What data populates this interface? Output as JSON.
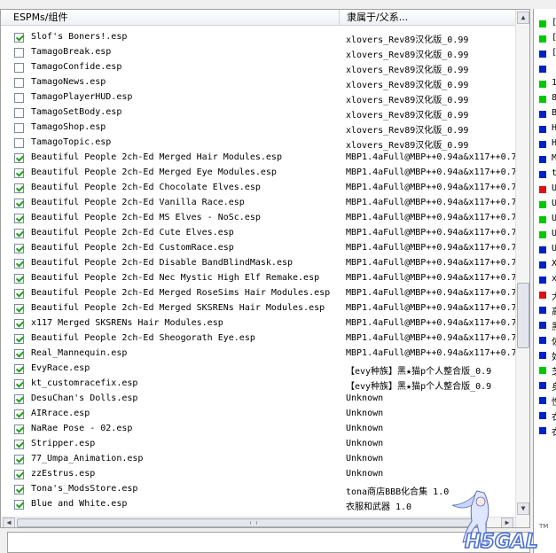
{
  "header": {
    "col1": "ESPMs/组件",
    "col2": "隶属于/父系..."
  },
  "rows": [
    {
      "checked": true,
      "name": "Slof's Boners!.esp",
      "master": "xlovers_Rev89汉化版_0.99"
    },
    {
      "checked": false,
      "name": "TamagoBreak.esp",
      "master": "xlovers_Rev89汉化版_0.99"
    },
    {
      "checked": false,
      "name": "TamagoConfide.esp",
      "master": "xlovers_Rev89汉化版_0.99"
    },
    {
      "checked": false,
      "name": "TamagoNews.esp",
      "master": "xlovers_Rev89汉化版_0.99"
    },
    {
      "checked": false,
      "name": "TamagoPlayerHUD.esp",
      "master": "xlovers_Rev89汉化版_0.99"
    },
    {
      "checked": false,
      "name": "TamagoSetBody.esp",
      "master": "xlovers_Rev89汉化版_0.99"
    },
    {
      "checked": false,
      "name": "TamagoShop.esp",
      "master": "xlovers_Rev89汉化版_0.99"
    },
    {
      "checked": false,
      "name": "TamagoTopic.esp",
      "master": "xlovers_Rev89汉化版_0.99"
    },
    {
      "checked": true,
      "name": "Beautiful People 2ch-Ed Merged Hair Modules.esp",
      "master": "MBP1.4aFull@MBP++0.94a&x117++0.7"
    },
    {
      "checked": true,
      "name": "Beautiful People 2ch-Ed Merged Eye Modules.esp",
      "master": "MBP1.4aFull@MBP++0.94a&x117++0.7"
    },
    {
      "checked": true,
      "name": "Beautiful People 2ch-Ed Chocolate Elves.esp",
      "master": "MBP1.4aFull@MBP++0.94a&x117++0.7"
    },
    {
      "checked": true,
      "name": "Beautiful People 2ch-Ed Vanilla Race.esp",
      "master": "MBP1.4aFull@MBP++0.94a&x117++0.7"
    },
    {
      "checked": true,
      "name": "Beautiful People 2ch-Ed MS Elves - NoSc.esp",
      "master": "MBP1.4aFull@MBP++0.94a&x117++0.7"
    },
    {
      "checked": true,
      "name": "Beautiful People 2ch-Ed Cute Elves.esp",
      "master": "MBP1.4aFull@MBP++0.94a&x117++0.7"
    },
    {
      "checked": true,
      "name": "Beautiful People 2ch-Ed CustomRace.esp",
      "master": "MBP1.4aFull@MBP++0.94a&x117++0.7"
    },
    {
      "checked": true,
      "name": "Beautiful People 2ch-Ed Disable BandBlindMask.esp",
      "master": "MBP1.4aFull@MBP++0.94a&x117++0.7"
    },
    {
      "checked": true,
      "name": "Beautiful People 2ch-Ed Nec Mystic High Elf Remake.esp",
      "master": "MBP1.4aFull@MBP++0.94a&x117++0.7"
    },
    {
      "checked": true,
      "name": "Beautiful People 2ch-Ed Merged RoseSims Hair Modules.esp",
      "master": "MBP1.4aFull@MBP++0.94a&x117++0.7"
    },
    {
      "checked": true,
      "name": "Beautiful People 2ch-Ed Merged SKSRENs Hair Modules.esp",
      "master": "MBP1.4aFull@MBP++0.94a&x117++0.7"
    },
    {
      "checked": true,
      "name": "x117 Merged SKSRENs Hair Modules.esp",
      "master": "MBP1.4aFull@MBP++0.94a&x117++0.7"
    },
    {
      "checked": true,
      "name": "Beautiful People 2ch-Ed Sheogorath Eye.esp",
      "master": "MBP1.4aFull@MBP++0.94a&x117++0.7"
    },
    {
      "checked": true,
      "name": "Real_Mannequin.esp",
      "master": "MBP1.4aFull@MBP++0.94a&x117++0.7"
    },
    {
      "checked": true,
      "name": "EvyRace.esp",
      "master": "【evy种族】黑★猫p个人整合版_0.9"
    },
    {
      "checked": true,
      "name": "kt_customracefix.esp",
      "master": "【evy种族】黑★猫p个人整合版_0.9"
    },
    {
      "checked": true,
      "name": "DesuChan's Dolls.esp",
      "master": "Unknown"
    },
    {
      "checked": true,
      "name": "AIRrace.esp",
      "master": "Unknown"
    },
    {
      "checked": true,
      "name": "NaRae Pose - 02.esp",
      "master": "Unknown"
    },
    {
      "checked": true,
      "name": "Stripper.esp",
      "master": "Unknown"
    },
    {
      "checked": true,
      "name": "77_Umpa_Animation.esp",
      "master": "Unknown"
    },
    {
      "checked": true,
      "name": "zzEstrus.esp",
      "master": "Unknown"
    },
    {
      "checked": true,
      "name": "Tona's_ModsStore.esp",
      "master": "tona商店BBB化合集 1.0"
    },
    {
      "checked": true,
      "name": "Blue and White.esp",
      "master": "衣服和武器 1.0"
    }
  ],
  "right_panel": [
    {
      "color": "#00c800",
      "text": "["
    },
    {
      "color": "#00c800",
      "text": "["
    },
    {
      "color": "#0020c8",
      "text": "["
    },
    {
      "color": "#0020c8",
      "text": ""
    },
    {
      "color": "#00c800",
      "text": "1"
    },
    {
      "color": "#00c800",
      "text": "8"
    },
    {
      "color": "#0020c8",
      "text": "B"
    },
    {
      "color": "#0020c8",
      "text": "H"
    },
    {
      "color": "#0020c8",
      "text": "H"
    },
    {
      "color": "#0020c8",
      "text": "M"
    },
    {
      "color": "#0020c8",
      "text": "t"
    },
    {
      "color": "#e01010",
      "text": "U"
    },
    {
      "color": "#00c800",
      "text": "U"
    },
    {
      "color": "#00c800",
      "text": "U"
    },
    {
      "color": "#00c800",
      "text": "U"
    },
    {
      "color": "#0020c8",
      "text": "U"
    },
    {
      "color": "#0020c8",
      "text": "X"
    },
    {
      "color": "#0020c8",
      "text": "x"
    },
    {
      "color": "#e01010",
      "text": "大"
    },
    {
      "color": "#0020c8",
      "text": "高"
    },
    {
      "color": "#0020c8",
      "text": "黑"
    },
    {
      "color": "#0020c8",
      "text": "佐"
    },
    {
      "color": "#0020c8",
      "text": "如"
    },
    {
      "color": "#00c800",
      "text": "芝"
    },
    {
      "color": "#0020c8",
      "text": "身"
    },
    {
      "color": "#0020c8",
      "text": "性"
    },
    {
      "color": "#0020c8",
      "text": "衣"
    },
    {
      "color": "#0020c8",
      "text": "衣"
    }
  ],
  "watermark": {
    "text": "H5GAL",
    "tm": "TM"
  },
  "icons": {
    "scroll_up": "triangle-up",
    "scroll_down": "triangle-down",
    "scroll_left": "triangle-left",
    "scroll_right": "triangle-right"
  }
}
